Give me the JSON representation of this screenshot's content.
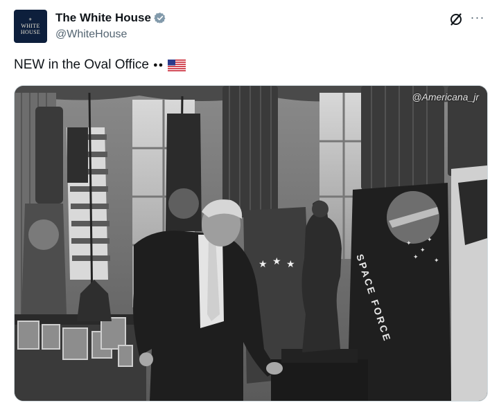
{
  "post": {
    "author_name": "The White House",
    "handle": "@WhiteHouse",
    "avatar_text_line1": "WHITE",
    "avatar_text_line2": "HOUSE",
    "text": "NEW in the Oval Office",
    "more_label": "···"
  },
  "media": {
    "watermark": "@Americana_jr",
    "flag_banner_text": "SPACE FORCE"
  },
  "colors": {
    "verified_badge": "#829aab",
    "avatar_bg": "#0d1f3c",
    "secondary_text": "#536471"
  },
  "icons": {
    "verified": "verified-badge-icon",
    "grok": "grok-icon",
    "more": "more-options-icon",
    "eyes": "eyes-emoji",
    "flag": "us-flag-emoji"
  }
}
